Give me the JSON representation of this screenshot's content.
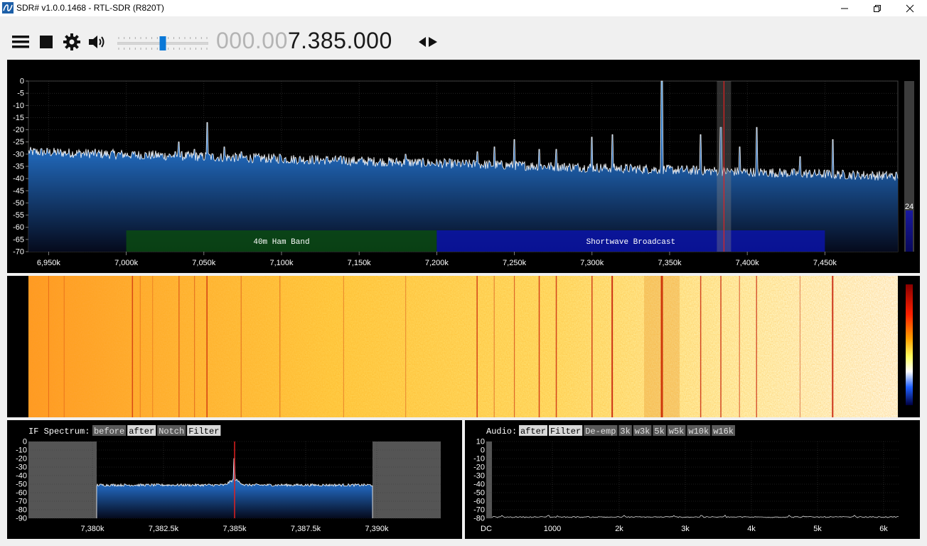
{
  "window": {
    "title": "SDR# v1.0.0.1468 - RTL-SDR (R820T)",
    "icons": [
      "app-logo-icon",
      "minimize-icon",
      "maximize-icon",
      "close-icon"
    ]
  },
  "toolbar": {
    "icons": [
      "menu-icon",
      "stop-icon",
      "gear-icon",
      "speaker-icon"
    ],
    "volume_level": 0.5,
    "frequency_dim": "000.00",
    "frequency_bright": "7.385.000"
  },
  "spectrum": {
    "db_labels": [
      "0",
      "-5",
      "-10",
      "-15",
      "-20",
      "-25",
      "-30",
      "-35",
      "-40",
      "-45",
      "-50",
      "-55",
      "-60",
      "-65",
      "-70"
    ],
    "freq_labels": [
      "6,950k",
      "7,000k",
      "7,050k",
      "7,100k",
      "7,150k",
      "7,200k",
      "7,250k",
      "7,300k",
      "7,350k",
      "7,400k",
      "7,450k"
    ],
    "bands": [
      {
        "label": "40m Ham Band",
        "from_khz": 7000,
        "to_khz": 7200,
        "color": "#0a4a12"
      },
      {
        "label": "Shortwave Broadcast",
        "from_khz": 7200,
        "to_khz": 7450,
        "color": "#0a14a8"
      }
    ],
    "tuned_khz": 7385,
    "range_khz": [
      6937,
      7497
    ],
    "db_range": [
      -70,
      0
    ],
    "contrast_value": "24"
  },
  "if_spectrum": {
    "label": "IF Spectrum:",
    "buttons": [
      "before",
      "after",
      "Notch",
      "Filter"
    ],
    "db_labels": [
      "0",
      "-10",
      "-20",
      "-30",
      "-40",
      "-50",
      "-60",
      "-70",
      "-80",
      "-90"
    ],
    "freq_labels": [
      "7,380k",
      "7,382.5k",
      "7,385k",
      "7,387.5k",
      "7,390k"
    ]
  },
  "audio": {
    "label": "Audio:",
    "buttons": [
      "after",
      "Filter",
      "De-emp",
      "3k",
      "w3k",
      "5k",
      "w5k",
      "w10k",
      "w16k"
    ],
    "db_labels": [
      "10",
      "0",
      "-10",
      "-20",
      "-30",
      "-40",
      "-50",
      "-60",
      "-70",
      "-80"
    ],
    "freq_labels": [
      "DC",
      "1000",
      "2k",
      "3k",
      "4k",
      "5k",
      "6k"
    ]
  }
}
